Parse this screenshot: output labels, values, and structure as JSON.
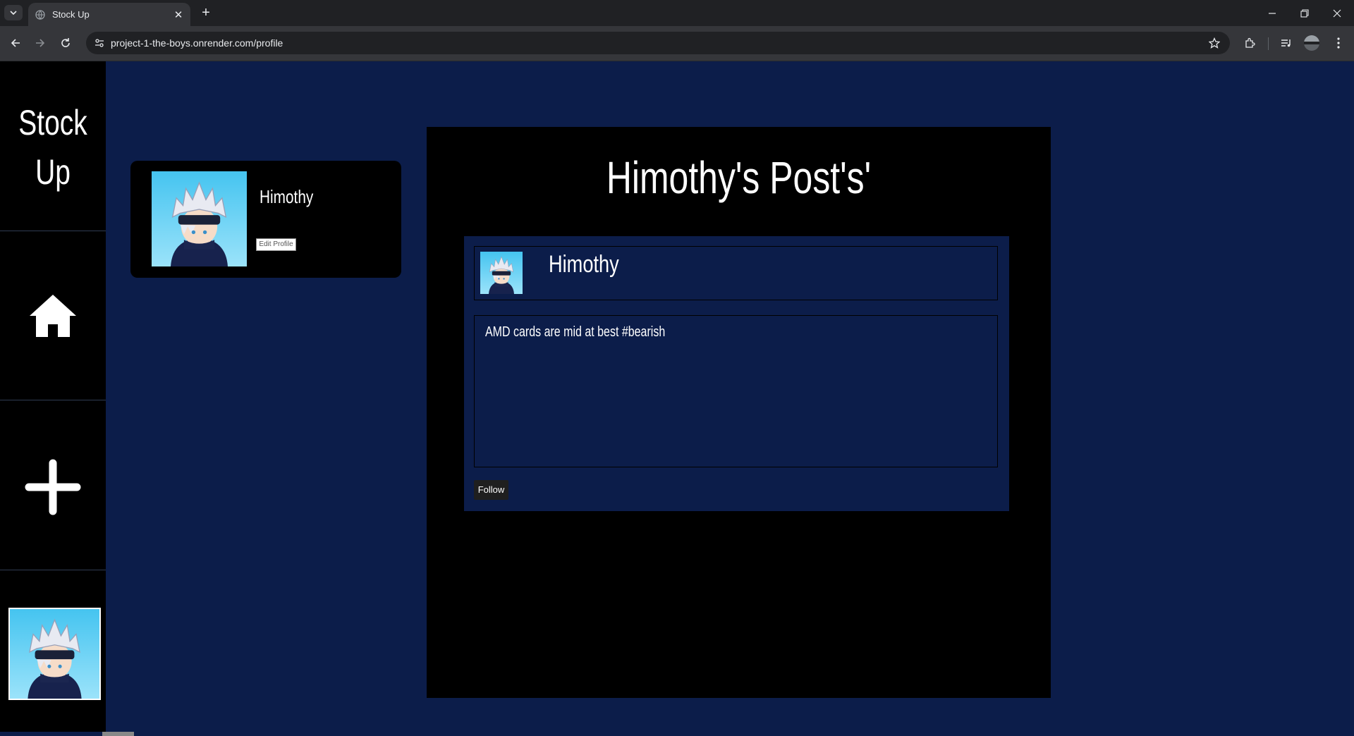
{
  "browser": {
    "tab_title": "Stock Up",
    "url": "project-1-the-boys.onrender.com/profile"
  },
  "sidebar": {
    "brand_line1": "Stock",
    "brand_line2": "Up",
    "items": [
      {
        "name": "home",
        "icon": "home-icon"
      },
      {
        "name": "create-post",
        "icon": "plus-icon"
      },
      {
        "name": "profile",
        "icon": "avatar"
      }
    ]
  },
  "profile": {
    "username": "Himothy",
    "edit_label": "Edit Profile"
  },
  "posts": {
    "title": "Himothy's Post's'",
    "items": [
      {
        "author": "Himothy",
        "content": "AMD cards are mid at best #bearish",
        "follow_label": "Follow"
      }
    ]
  },
  "colors": {
    "page_background": "#0c1d4a",
    "panel_background": "#000000",
    "avatar_sky": "#5fcff2"
  }
}
